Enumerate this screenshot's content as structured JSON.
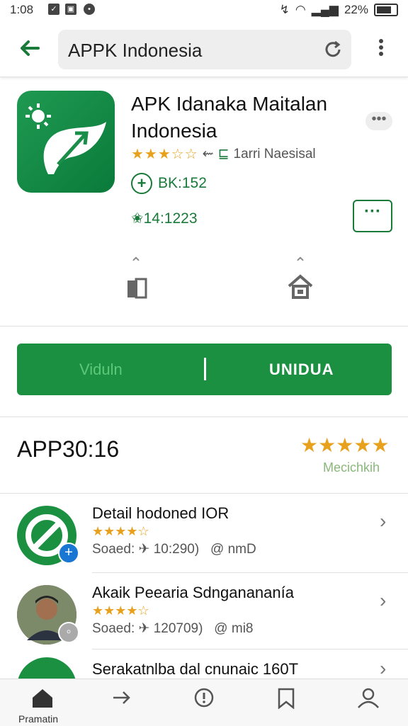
{
  "status_bar": {
    "time": "1:08",
    "battery": "22%"
  },
  "app_bar": {
    "search_text": "APPK Indonesia"
  },
  "app": {
    "title": "APK Idanaka Maitalan Indonesia",
    "more_chip": "•••",
    "rating_stars": "★★★☆☆",
    "rating_label": "1arri Naesisal",
    "size": "BK:152",
    "downloads_label": "14:1223",
    "overflow": "···"
  },
  "install_bar": {
    "left_label": "Viduln",
    "right_label": "UNIDUA"
  },
  "section": {
    "title": "APP30:16",
    "stars": "★★★★★",
    "label": "Mecichkih"
  },
  "list": [
    {
      "title": "Detail hodoned IOR",
      "stars": "★★★★☆",
      "meta_left": "Soaed:",
      "meta_value": "10:290)",
      "meta_right": "nmD",
      "badge": "+"
    },
    {
      "title": "Akaik Peearia Sdnganananía",
      "stars": "★★★★☆",
      "meta_left": "Soaed:",
      "meta_value": "120709)",
      "meta_right": "mi8",
      "badge": "◦"
    },
    {
      "title": "Serakatnlba dal cnunaic 160T"
    }
  ],
  "bottom_nav": {
    "home_label": "Pramatin"
  },
  "colors": {
    "brand": "#1a9040",
    "star": "#e8a11c"
  }
}
